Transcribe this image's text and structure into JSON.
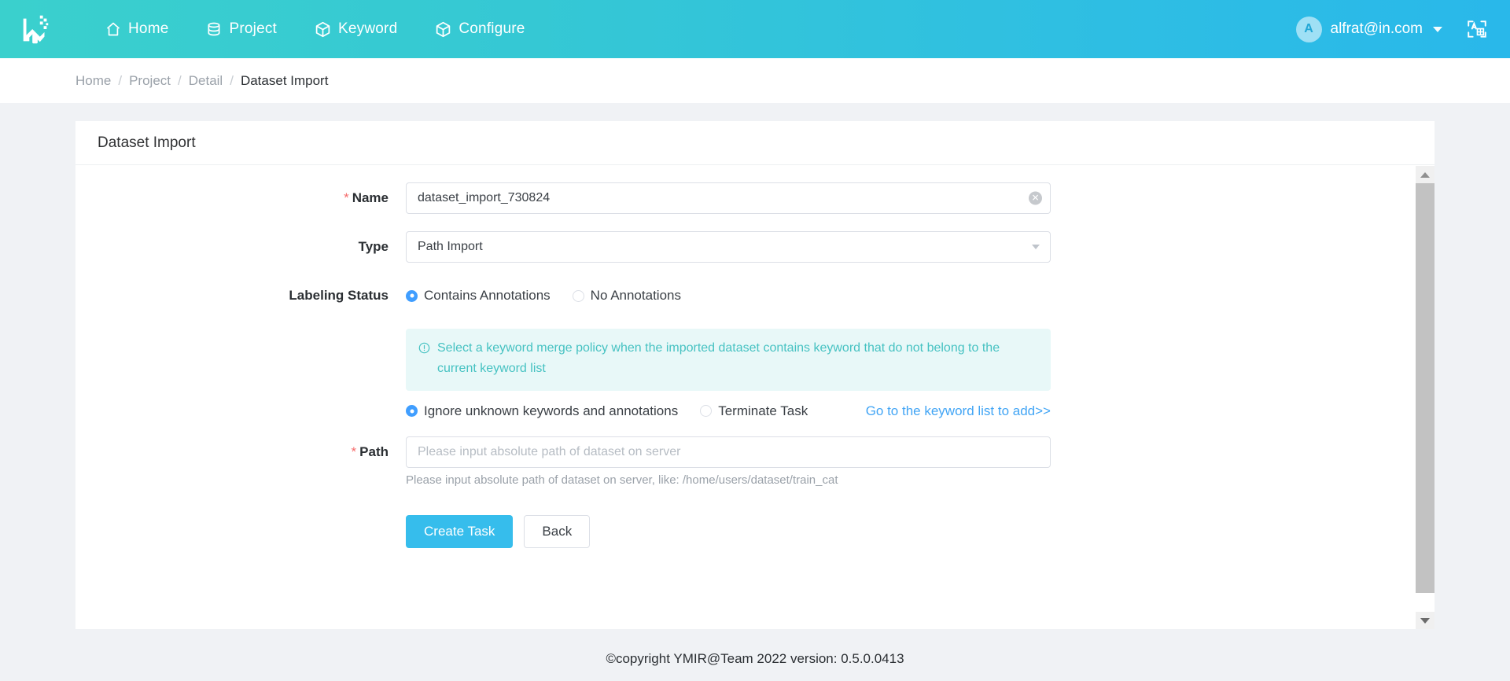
{
  "header": {
    "logo_icon": "ymir-logo-icon",
    "nav": [
      {
        "label": "Home",
        "icon": "home-icon"
      },
      {
        "label": "Project",
        "icon": "database-icon"
      },
      {
        "label": "Keyword",
        "icon": "cube-icon"
      },
      {
        "label": "Configure",
        "icon": "cube-icon"
      }
    ],
    "user": {
      "avatar_initial": "A",
      "email": "alfrat@in.com",
      "caret_icon": "chevron-down-icon"
    },
    "language_icon": "translate-icon",
    "gradient_start": "#3ad0cd",
    "gradient_end": "#29b8ea"
  },
  "breadcrumb": {
    "items": [
      "Home",
      "Project",
      "Detail",
      "Dataset Import"
    ],
    "separator": "/"
  },
  "card": {
    "title": "Dataset Import"
  },
  "form": {
    "name": {
      "label": "Name",
      "required_marker": "*",
      "value": "dataset_import_730824",
      "clear_icon": "clear-circle-icon"
    },
    "type": {
      "label": "Type",
      "value": "Path Import",
      "caret_icon": "chevron-down-icon"
    },
    "labeling_status": {
      "label": "Labeling Status",
      "options": [
        {
          "label": "Contains Annotations",
          "checked": true
        },
        {
          "label": "No Annotations",
          "checked": false
        }
      ]
    },
    "alert": {
      "icon": "info-circle-icon",
      "text": "Select a keyword merge policy when the imported dataset contains keyword that do not belong to the current keyword list",
      "bg_color": "#e8f8f8",
      "text_color": "#46c2c2"
    },
    "merge_policy": {
      "options": [
        {
          "label": "Ignore unknown keywords and annotations",
          "checked": true
        },
        {
          "label": "Terminate Task",
          "checked": false
        }
      ],
      "link_label": "Go to the keyword list to add>>",
      "link_color": "#42a5f5"
    },
    "path": {
      "label": "Path",
      "required_marker": "*",
      "value": "",
      "placeholder": "Please input absolute path of dataset on server",
      "help_text": "Please input absolute path of dataset on server, like: /home/users/dataset/train_cat"
    },
    "buttons": {
      "primary_label": "Create Task",
      "default_label": "Back",
      "primary_color": "#36bdec"
    }
  },
  "scrollbar": {
    "up_icon": "triangle-up-icon",
    "down_icon": "triangle-down-icon"
  },
  "footer": {
    "text": "©copyright YMIR@Team 2022 version: 0.5.0.0413"
  }
}
